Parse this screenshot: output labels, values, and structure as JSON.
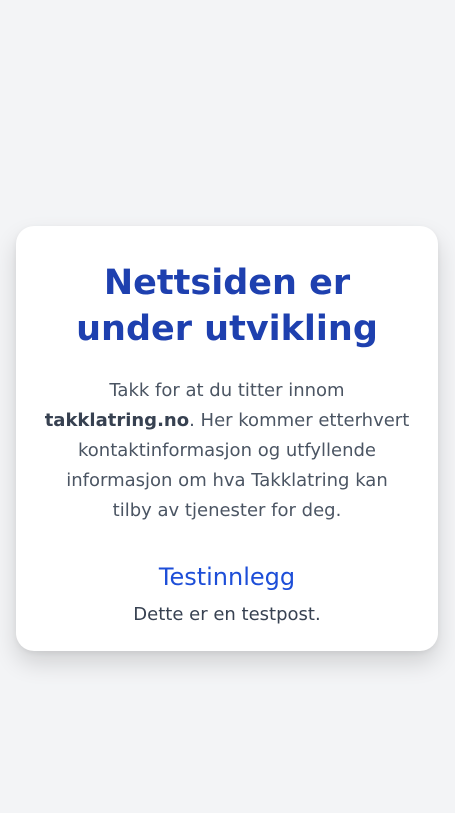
{
  "card": {
    "title": "Nettsiden er under utvikling",
    "intro_before": "Takk for at du titter innom ",
    "intro_bold": "takklatring.no",
    "intro_after": ". Her kommer etterhvert kontaktinformasjon og utfyllende informasjon om hva Takklatring kan tilby av tjenester for deg."
  },
  "post": {
    "title": "Testinnlegg",
    "body": "Dette er en testpost."
  },
  "colors": {
    "background": "#f3f4f6",
    "card": "#ffffff",
    "heading_blue": "#1e40af",
    "post_title_blue": "#1d4ed8",
    "text_gray": "#4b5563"
  }
}
